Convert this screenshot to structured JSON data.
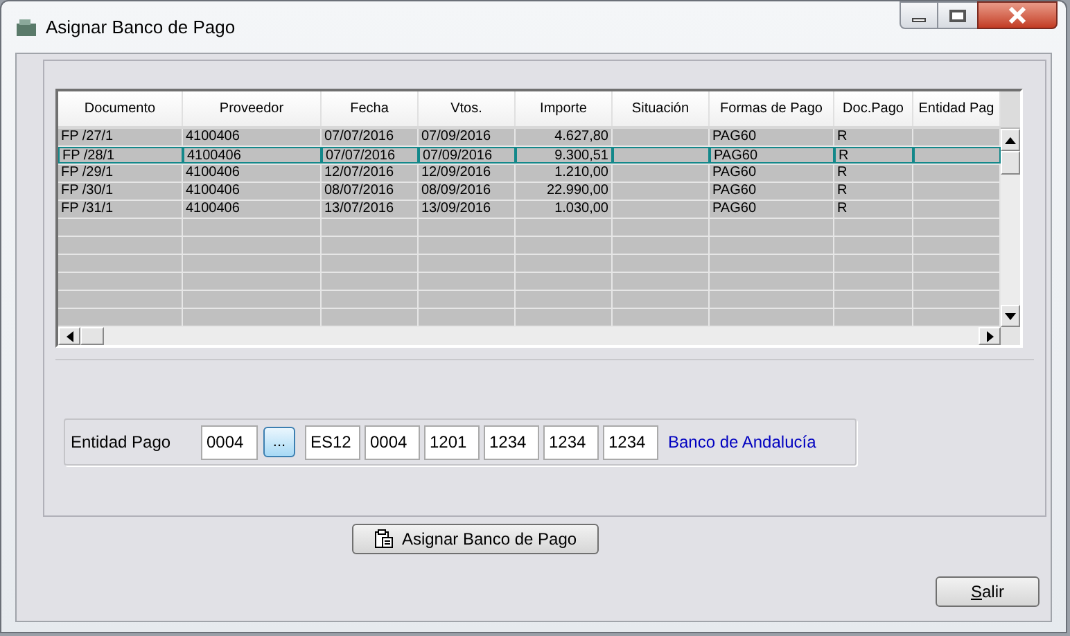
{
  "window": {
    "title": "Asignar Banco de Pago"
  },
  "table": {
    "columns": [
      "Documento",
      "Proveedor",
      "Fecha",
      "Vtos.",
      "Importe",
      "Situación",
      "Formas de Pago",
      "Doc.Pago",
      "Entidad Pag"
    ],
    "rows": [
      {
        "selected": false,
        "cells": [
          "FP /27/1",
          "4100406",
          "07/07/2016",
          "07/09/2016",
          "4.627,80",
          "",
          "PAG60",
          "R",
          ""
        ]
      },
      {
        "selected": true,
        "cells": [
          "FP /28/1",
          "4100406",
          "07/07/2016",
          "07/09/2016",
          "9.300,51",
          "",
          "PAG60",
          "R",
          ""
        ]
      },
      {
        "selected": false,
        "cells": [
          "FP /29/1",
          "4100406",
          "12/07/2016",
          "12/09/2016",
          "1.210,00",
          "",
          "PAG60",
          "R",
          ""
        ]
      },
      {
        "selected": false,
        "cells": [
          "FP /30/1",
          "4100406",
          "08/07/2016",
          "08/09/2016",
          "22.990,00",
          "",
          "PAG60",
          "R",
          ""
        ]
      },
      {
        "selected": false,
        "cells": [
          "FP /31/1",
          "4100406",
          "13/07/2016",
          "13/09/2016",
          "1.030,00",
          "",
          "PAG60",
          "R",
          ""
        ]
      }
    ]
  },
  "entidad": {
    "label": "Entidad Pago",
    "code": "0004",
    "browse": "...",
    "iban": [
      "ES12",
      "0004",
      "1201",
      "1234",
      "1234",
      "1234"
    ],
    "bank_name": "Banco de Andalucía"
  },
  "buttons": {
    "assign": "Asignar Banco de Pago",
    "exit": "Salir"
  }
}
